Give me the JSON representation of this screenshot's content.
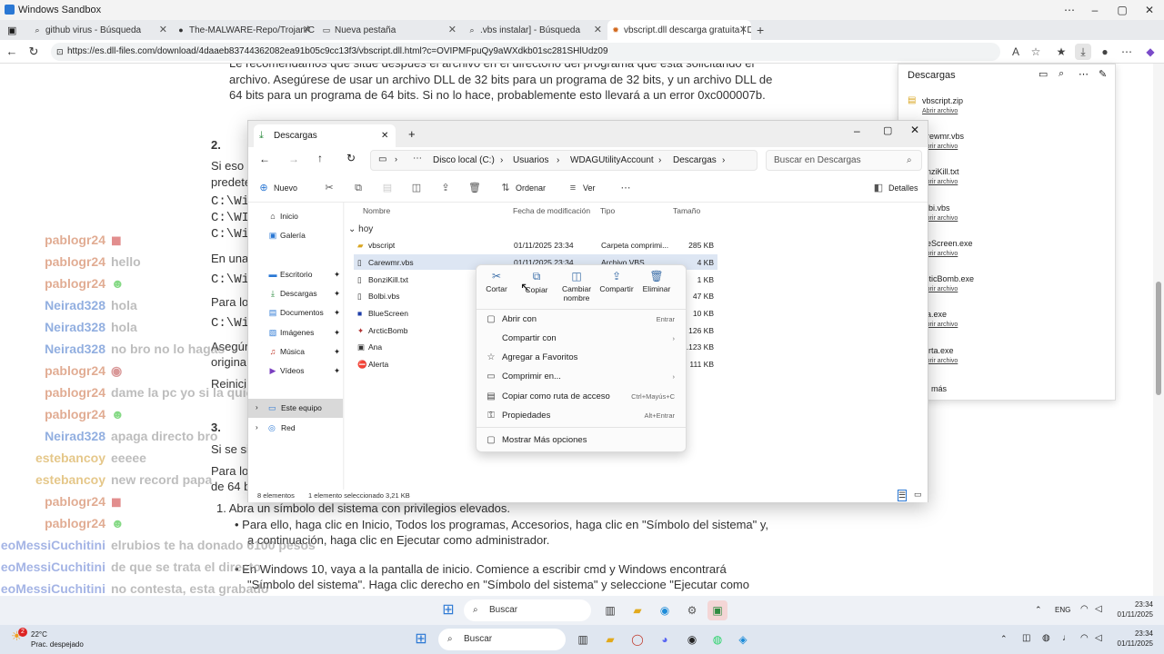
{
  "sandbox": {
    "title": "Windows Sandbox"
  },
  "tabs": [
    {
      "label": "github virus - Búsqueda",
      "icon": "search-icon"
    },
    {
      "label": "The-MALWARE-Repo/Trojan/Care",
      "icon": "github-icon"
    },
    {
      "label": "Nueva pestaña",
      "icon": "new-tab-icon"
    },
    {
      "label": ".vbs instalar] - Búsqueda",
      "icon": "search-icon"
    },
    {
      "label": "vbscript.dll descarga gratuita | DLL",
      "icon": "dll-files-icon"
    }
  ],
  "address": {
    "url": "https://es.dll-files.com/download/4daaeb83744362082ea91b05c9cc13f3/vbscript.dll.html?c=OVIPMFpuQy9aWXdkb01sc281SHlUdz09"
  },
  "page": {
    "lines": [
      "Le recomendamos que sitúe después el archivo en el directorio del programa que esta solicitando el",
      "archivo. Asegúrese de usar un archivo DLL de 32 bits para un programa de 32 bits, y un archivo DLL de",
      "64 bits para un programa de 64 bits. Si no lo hace, probablemente esto llevará a un error 0xc000007b."
    ],
    "step2": "2.",
    "step3": "3.",
    "frag": [
      "Si eso n",
      "predete",
      "C:\\Wi",
      "C:\\WI",
      "C:\\Wi",
      "En una",
      "C:\\Wi",
      "Para los",
      "C:\\Wi",
      "Asegúr",
      "origina",
      "Reinici",
      "Si se sig",
      "Para los",
      "de 64 b"
    ],
    "list1": "Abra un símbolo del sistema con privilegios elevados.",
    "bullet1a": "Para ello, haga clic en Inicio, Todos los programas, Accesorios, haga clic en \"Símbolo del sistema\" y,",
    "bullet1b": "a continuación, haga clic en Ejecutar como administrador.",
    "bullet2a": "En Windows 10, vaya a la pantalla de inicio. Comience a escribir cmd y Windows encontrará",
    "bullet2b": "\"Símbolo del sistema\". Haga clic derecho en \"Símbolo del sistema\" y seleccione \"Ejecutar como"
  },
  "chat": [
    {
      "user": "pablogr24",
      "msg": "",
      "color": "#c96a3c"
    },
    {
      "user": "pablogr24",
      "msg": "hello",
      "color": "#c96a3c"
    },
    {
      "user": "pablogr24",
      "msg": "",
      "color": "#c96a3c"
    },
    {
      "user": "Neirad328",
      "msg": "hola",
      "color": "#3a6ec8"
    },
    {
      "user": "Neirad328",
      "msg": "hola",
      "color": "#3a6ec8"
    },
    {
      "user": "Neirad328",
      "msg": "no bro no lo hagas",
      "color": "#3a6ec8"
    },
    {
      "user": "pablogr24",
      "msg": "",
      "color": "#c96a3c"
    },
    {
      "user": "pablogr24",
      "msg": "dame la pc yo si la quiero",
      "color": "#c96a3c"
    },
    {
      "user": "pablogr24",
      "msg": "",
      "color": "#c96a3c"
    },
    {
      "user": "Neirad328",
      "msg": "apaga directo bro",
      "color": "#3a6ec8"
    },
    {
      "user": "estebancoy",
      "msg": "eeeee",
      "color": "#d09a2a"
    },
    {
      "user": "estebancoy",
      "msg": "new record papa",
      "color": "#d09a2a"
    },
    {
      "user": "pablogr24",
      "msg": "",
      "color": "#c96a3c"
    },
    {
      "user": "pablogr24",
      "msg": "",
      "color": "#c96a3c"
    },
    {
      "user": "eoMessiCuchitini",
      "msg": "elrubios te ha donado 6100 pesos",
      "color": "#5a78d0"
    },
    {
      "user": "eoMessiCuchitini",
      "msg": "de que se trata el directo",
      "color": "#5a78d0"
    },
    {
      "user": "eoMessiCuchitini",
      "msg": "no contesta, esta grabado",
      "color": "#5a78d0"
    }
  ],
  "downloads": {
    "title": "Descargas",
    "items": [
      {
        "name": "vbscript.zip",
        "action": "Abrir archivo"
      },
      {
        "name": "arewmr.vbs",
        "action": "Abrir archivo"
      },
      {
        "name": "onziKill.txt",
        "action": "Abrir archivo"
      },
      {
        "name": "olbi.vbs",
        "action": "Abrir archivo"
      },
      {
        "name": "ueScreen.exe",
        "action": "Abrir archivo"
      },
      {
        "name": "rcticBomb.exe",
        "action": "Abrir archivo"
      },
      {
        "name": "na.exe",
        "action": "Abrir archivo"
      },
      {
        "name": "lerta.exe",
        "action": "Abrir archivo"
      }
    ],
    "more": "más"
  },
  "explorer": {
    "tab": "Descargas",
    "breadcrumb": [
      "Disco local (C:)",
      "Usuarios",
      "WDAGUtilityAccount",
      "Descargas"
    ],
    "search_placeholder": "Buscar en Descargas",
    "toolbar": {
      "new": "Nuevo",
      "sort": "Ordenar",
      "view": "Ver",
      "details": "Detalles"
    },
    "sidebar": [
      {
        "label": "Inicio",
        "icon": "home-icon"
      },
      {
        "label": "Galería",
        "icon": "gallery-icon"
      },
      {
        "label": "Escritorio",
        "icon": "desktop-icon"
      },
      {
        "label": "Descargas",
        "icon": "download-icon"
      },
      {
        "label": "Documentos",
        "icon": "documents-icon"
      },
      {
        "label": "Imágenes",
        "icon": "pictures-icon"
      },
      {
        "label": "Música",
        "icon": "music-icon"
      },
      {
        "label": "Vídeos",
        "icon": "videos-icon"
      },
      {
        "label": "Este equipo",
        "icon": "pc-icon"
      },
      {
        "label": "Red",
        "icon": "network-icon"
      }
    ],
    "columns": [
      "Nombre",
      "Fecha de modificación",
      "Tipo",
      "Tamaño"
    ],
    "group": "hoy",
    "files": [
      {
        "name": "vbscript",
        "date": "01/11/2025 23:34",
        "type": "Carpeta comprimi...",
        "size": "285 KB"
      },
      {
        "name": "Carewmr.vbs",
        "date": "01/11/2025 23:34",
        "type": "Archivo VBS",
        "size": "4 KB"
      },
      {
        "name": "BonziKill.txt",
        "date": "",
        "type": "",
        "size": "1 KB"
      },
      {
        "name": "Bolbi.vbs",
        "date": "",
        "type": "",
        "size": "47 KB"
      },
      {
        "name": "BlueScreen",
        "date": "",
        "type": "",
        "size": "10 KB"
      },
      {
        "name": "ArcticBomb",
        "date": "",
        "type": "",
        "size": "126 KB"
      },
      {
        "name": "Ana",
        "date": "",
        "type": "",
        "size": "2.123 KB"
      },
      {
        "name": "Alerta",
        "date": "",
        "type": "",
        "size": "111 KB"
      }
    ],
    "status": {
      "count": "8 elementos",
      "selected": "1 elemento seleccionado  3,21 KB"
    }
  },
  "context_menu": {
    "top": [
      {
        "label": "Cortar",
        "icon": "cut-icon"
      },
      {
        "label": "Copiar",
        "icon": "copy-icon"
      },
      {
        "label": "Cambiar nombre",
        "icon": "rename-icon"
      },
      {
        "label": "Compartir",
        "icon": "share-icon"
      },
      {
        "label": "Eliminar",
        "icon": "delete-icon"
      }
    ],
    "items": [
      {
        "label": "Abrir con",
        "shortcut": "Entrar",
        "icon": "open-with-icon"
      },
      {
        "label": "Compartir con",
        "shortcut": "",
        "icon": "share-with-icon"
      },
      {
        "label": "Agregar a Favoritos",
        "shortcut": "",
        "icon": "star-icon"
      },
      {
        "label": "Comprimir en...",
        "shortcut": "",
        "icon": "zip-icon"
      },
      {
        "label": "Copiar como ruta de acceso",
        "shortcut": "Ctrl+Mayús+C",
        "icon": "path-icon"
      },
      {
        "label": "Propiedades",
        "shortcut": "Alt+Entrar",
        "icon": "properties-icon"
      },
      {
        "label": "Mostrar Más opciones",
        "shortcut": "",
        "icon": "more-options-icon"
      }
    ]
  },
  "taskbar": {
    "search": "Buscar",
    "lang": "ENG",
    "time": "23:34",
    "date": "01/11/2025",
    "search2": "Buscar",
    "time2": "23:34",
    "date2": "01/11/2025",
    "weather_temp": "22°C",
    "weather_desc": "Prac. despejado",
    "badge": "2"
  }
}
